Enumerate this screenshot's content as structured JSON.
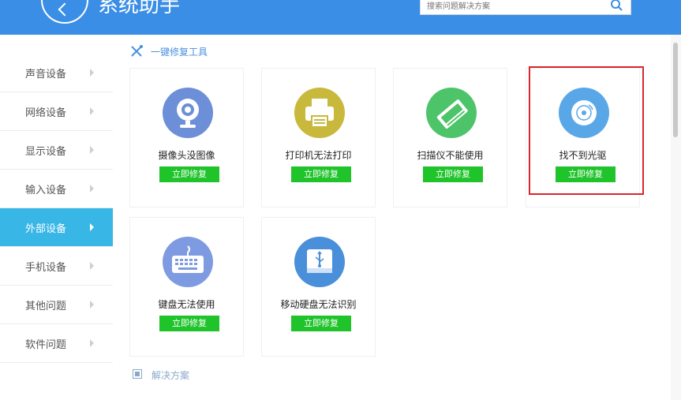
{
  "header": {
    "title": "系统助手",
    "search": {
      "placeholder": "搜索问题解决方案"
    }
  },
  "sidebar": {
    "items": [
      {
        "label": "声音设备",
        "active": false
      },
      {
        "label": "网络设备",
        "active": false
      },
      {
        "label": "显示设备",
        "active": false
      },
      {
        "label": "输入设备",
        "active": false
      },
      {
        "label": "外部设备",
        "active": true
      },
      {
        "label": "手机设备",
        "active": false
      },
      {
        "label": "其他问题",
        "active": false
      },
      {
        "label": "软件问题",
        "active": false
      }
    ]
  },
  "section": {
    "title": "一键修复工具"
  },
  "tools": [
    {
      "label": "摄像头没图像",
      "button": "立即修复",
      "icon": "webcam-icon",
      "color": "#6d8fd8"
    },
    {
      "label": "打印机无法打印",
      "button": "立即修复",
      "icon": "printer-icon",
      "color": "#c8b93c"
    },
    {
      "label": "扫描仪不能使用",
      "button": "立即修复",
      "icon": "scanner-icon",
      "color": "#4ec46a"
    },
    {
      "label": "找不到光驱",
      "button": "立即修复",
      "icon": "disc-icon",
      "color": "#5aa7e8"
    },
    {
      "label": "键盘无法使用",
      "button": "立即修复",
      "icon": "keyboard-icon",
      "color": "#7e9be2"
    },
    {
      "label": "移动硬盘无法识别",
      "button": "立即修复",
      "icon": "usb-drive-icon",
      "color": "#4a8fd9"
    }
  ],
  "footer": {
    "title": "解决方案"
  },
  "colors": {
    "header": "#3a8ee6",
    "active_sidebar": "#38b6e6",
    "fix_button": "#1fc32a",
    "highlight": "#d9262c"
  }
}
